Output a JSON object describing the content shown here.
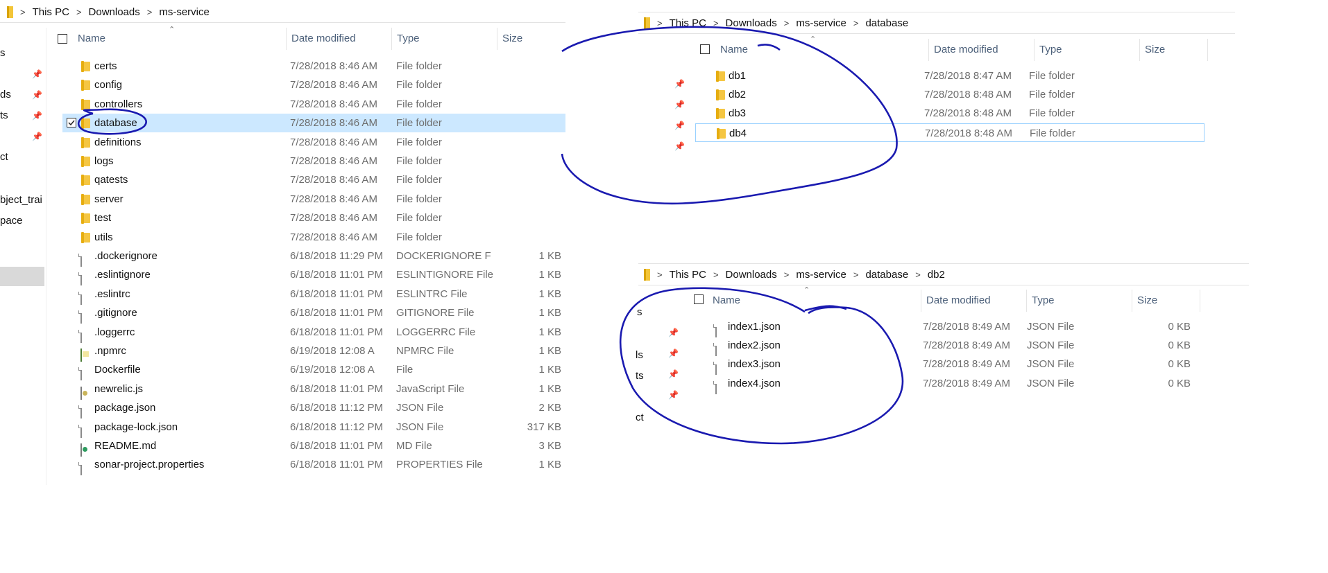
{
  "panel1": {
    "breadcrumb": [
      "This PC",
      "Downloads",
      "ms-service"
    ],
    "columns": {
      "name": "Name",
      "date": "Date modified",
      "type": "Type",
      "size": "Size"
    },
    "nav_partial": [
      "s",
      "ds",
      "ts",
      "ct",
      "bject_trai",
      "pace"
    ],
    "rows": [
      {
        "name": "certs",
        "date": "7/28/2018 8:46 AM",
        "type": "File folder",
        "size": "",
        "icon": "folder-icon"
      },
      {
        "name": "config",
        "date": "7/28/2018 8:46 AM",
        "type": "File folder",
        "size": "",
        "icon": "folder-icon"
      },
      {
        "name": "controllers",
        "date": "7/28/2018 8:46 AM",
        "type": "File folder",
        "size": "",
        "icon": "folder-icon"
      },
      {
        "name": "database",
        "date": "7/28/2018 8:46 AM",
        "type": "File folder",
        "size": "",
        "icon": "folder-icon",
        "selected": true
      },
      {
        "name": "definitions",
        "date": "7/28/2018 8:46 AM",
        "type": "File folder",
        "size": "",
        "icon": "folder-icon"
      },
      {
        "name": "logs",
        "date": "7/28/2018 8:46 AM",
        "type": "File folder",
        "size": "",
        "icon": "folder-icon"
      },
      {
        "name": "qatests",
        "date": "7/28/2018 8:46 AM",
        "type": "File folder",
        "size": "",
        "icon": "folder-icon"
      },
      {
        "name": "server",
        "date": "7/28/2018 8:46 AM",
        "type": "File folder",
        "size": "",
        "icon": "folder-icon"
      },
      {
        "name": "test",
        "date": "7/28/2018 8:46 AM",
        "type": "File folder",
        "size": "",
        "icon": "folder-icon"
      },
      {
        "name": "utils",
        "date": "7/28/2018 8:46 AM",
        "type": "File folder",
        "size": "",
        "icon": "folder-icon"
      },
      {
        "name": ".dockerignore",
        "date": "6/18/2018 11:29 PM",
        "type": "DOCKERIGNORE F",
        "size": "1 KB",
        "icon": "file-icon"
      },
      {
        "name": ".eslintignore",
        "date": "6/18/2018 11:01 PM",
        "type": "ESLINTIGNORE File",
        "size": "1 KB",
        "icon": "file-icon"
      },
      {
        "name": ".eslintrc",
        "date": "6/18/2018 11:01 PM",
        "type": "ESLINTRC File",
        "size": "1 KB",
        "icon": "file-icon"
      },
      {
        "name": ".gitignore",
        "date": "6/18/2018 11:01 PM",
        "type": "GITIGNORE File",
        "size": "1 KB",
        "icon": "file-icon"
      },
      {
        "name": ".loggerrc",
        "date": "6/18/2018 11:01 PM",
        "type": "LOGGERRC File",
        "size": "1 KB",
        "icon": "file-icon"
      },
      {
        "name": ".npmrc",
        "date": "6/19/2018 12:08 A",
        "type": "NPMRC File",
        "size": "1 KB",
        "icon": "npm-file-icon"
      },
      {
        "name": "Dockerfile",
        "date": "6/19/2018 12:08 A",
        "type": "File",
        "size": "1 KB",
        "icon": "file-icon"
      },
      {
        "name": "newrelic.js",
        "date": "6/18/2018 11:01 PM",
        "type": "JavaScript File",
        "size": "1 KB",
        "icon": "js-file-icon"
      },
      {
        "name": "package.json",
        "date": "6/18/2018 11:12 PM",
        "type": "JSON File",
        "size": "2 KB",
        "icon": "file-icon"
      },
      {
        "name": "package-lock.json",
        "date": "6/18/2018 11:12 PM",
        "type": "JSON File",
        "size": "317 KB",
        "icon": "file-icon"
      },
      {
        "name": "README.md",
        "date": "6/18/2018 11:01 PM",
        "type": "MD File",
        "size": "3 KB",
        "icon": "md-file-icon"
      },
      {
        "name": "sonar-project.properties",
        "date": "6/18/2018 11:01 PM",
        "type": "PROPERTIES File",
        "size": "1 KB",
        "icon": "file-icon"
      }
    ]
  },
  "panel2": {
    "breadcrumb": [
      "This PC",
      "Downloads",
      "ms-service",
      "database"
    ],
    "columns": {
      "name": "Name",
      "date": "Date modified",
      "type": "Type",
      "size": "Size"
    },
    "rows": [
      {
        "name": "db1",
        "date": "7/28/2018 8:47 AM",
        "type": "File folder",
        "size": ""
      },
      {
        "name": "db2",
        "date": "7/28/2018 8:48 AM",
        "type": "File folder",
        "size": ""
      },
      {
        "name": "db3",
        "date": "7/28/2018 8:48 AM",
        "type": "File folder",
        "size": ""
      },
      {
        "name": "db4",
        "date": "7/28/2018 8:48 AM",
        "type": "File folder",
        "size": "",
        "outlined": true
      }
    ]
  },
  "panel3": {
    "breadcrumb": [
      "This PC",
      "Downloads",
      "ms-service",
      "database",
      "db2"
    ],
    "columns": {
      "name": "Name",
      "date": "Date modified",
      "type": "Type",
      "size": "Size"
    },
    "nav_partial": [
      "s",
      "ls",
      "ts",
      "ct"
    ],
    "rows": [
      {
        "name": "index1.json",
        "date": "7/28/2018 8:49 AM",
        "type": "JSON File",
        "size": "0 KB"
      },
      {
        "name": "index2.json",
        "date": "7/28/2018 8:49 AM",
        "type": "JSON File",
        "size": "0 KB"
      },
      {
        "name": "index3.json",
        "date": "7/28/2018 8:49 AM",
        "type": "JSON File",
        "size": "0 KB"
      },
      {
        "name": "index4.json",
        "date": "7/28/2018 8:49 AM",
        "type": "JSON File",
        "size": "0 KB"
      }
    ]
  },
  "colors": {
    "selection": "#cce8ff",
    "annotation_ink": "#1a1ab0",
    "folder": "#f3c538"
  }
}
